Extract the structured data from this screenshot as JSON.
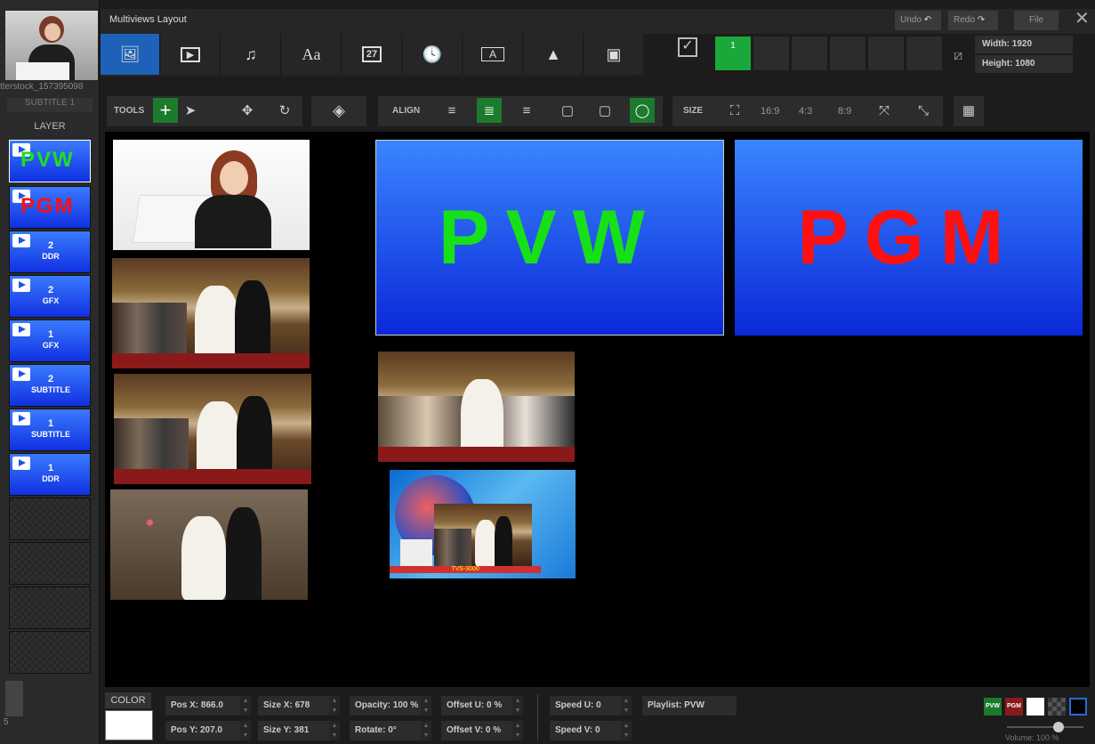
{
  "app": {
    "title": "Multiviews Layout"
  },
  "top_actions": {
    "undo": "Undo",
    "redo": "Redo",
    "file": "File"
  },
  "media_tabs": [
    {
      "name": "image",
      "glyph": "🖼"
    },
    {
      "name": "video",
      "glyph": "▶"
    },
    {
      "name": "music",
      "glyph": "♫"
    },
    {
      "name": "text",
      "glyph": "Aa"
    },
    {
      "name": "calendar",
      "glyph": "27"
    },
    {
      "name": "clock",
      "glyph": "🕓"
    },
    {
      "name": "caption",
      "glyph": "A"
    },
    {
      "name": "shapes",
      "glyph": "▲"
    },
    {
      "name": "playlist",
      "glyph": "▣"
    }
  ],
  "slots": {
    "active_label": "1"
  },
  "output": {
    "width_label": "Width: 1920",
    "height_label": "Height: 1080"
  },
  "left": {
    "thumb_caption": "tterstock_157395098",
    "subtitle_tab": "SUBTITLE 1",
    "layer_header": "LAYER",
    "layers": [
      {
        "type": "big",
        "big": "PVW",
        "color": "#20e020"
      },
      {
        "type": "big",
        "big": "PGM",
        "color": "#ff1010"
      },
      {
        "type": "item",
        "num": "2",
        "label": "DDR"
      },
      {
        "type": "item",
        "num": "2",
        "label": "GFX"
      },
      {
        "type": "item",
        "num": "1",
        "label": "GFX"
      },
      {
        "type": "item",
        "num": "2",
        "label": "SUBTITLE"
      },
      {
        "type": "item",
        "num": "1",
        "label": "SUBTITLE"
      },
      {
        "type": "item",
        "num": "1",
        "label": "DDR"
      }
    ],
    "bottom_num": "5"
  },
  "toolbar": {
    "tools": "TOOLS",
    "align": "ALIGN",
    "size": "SIZE",
    "ratios": [
      "16:9",
      "4:3",
      "8:9"
    ]
  },
  "canvas": {
    "pvw_text": "PVW",
    "pvw_color": "#18e018",
    "pgm_text": "PGM",
    "pgm_color": "#ff1010",
    "tvs_label": "TVS-3000"
  },
  "properties": {
    "color_label": "COLOR",
    "pos_x": "Pos X: 866.0",
    "pos_y": "Pos Y: 207.0",
    "size_x": "Size X: 678",
    "size_y": "Size Y: 381",
    "opacity": "Opacity: 100 %",
    "rotate": "Rotate: 0°",
    "offset_u": "Offset U: 0 %",
    "offset_v": "Offset V: 0 %",
    "speed_u": "Speed U: 0",
    "speed_v": "Speed V: 0",
    "playlist": "Playlist: PVW"
  },
  "mini_buttons": {
    "pvw": "PVW",
    "pgm": "PGM"
  },
  "volume": {
    "label": "Volume: 100 %",
    "level": 100
  }
}
